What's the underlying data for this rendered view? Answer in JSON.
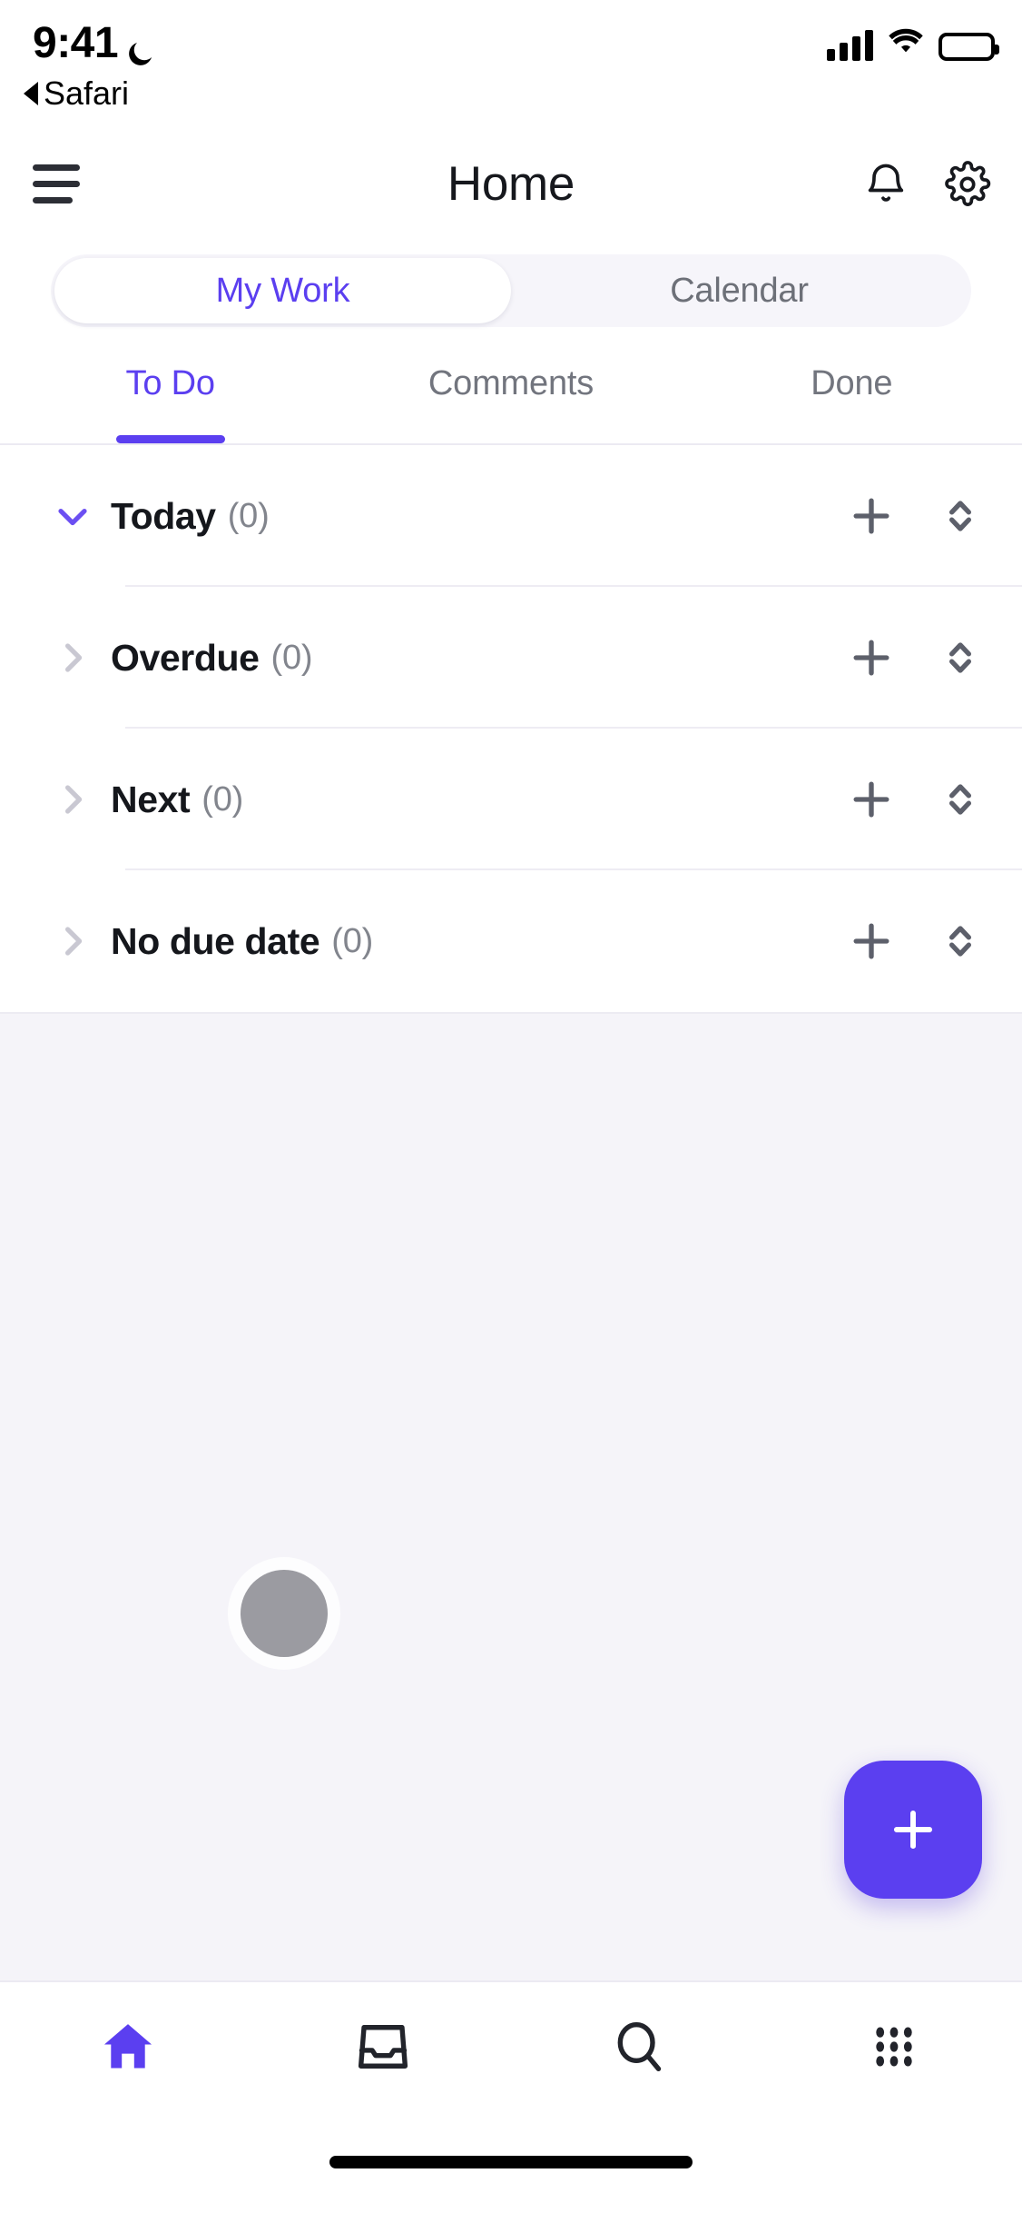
{
  "status_bar": {
    "time": "9:41",
    "dnd_icon": "moon-icon",
    "back_label": "Safari",
    "signal_icon": "cellular-signal-icon",
    "wifi_icon": "wifi-icon",
    "battery_icon": "battery-icon"
  },
  "header": {
    "menu_icon": "hamburger-menu-icon",
    "title": "Home",
    "notifications_icon": "bell-icon",
    "settings_icon": "gear-icon"
  },
  "segmented_control": {
    "options": [
      {
        "label": "My Work",
        "active": true
      },
      {
        "label": "Calendar",
        "active": false
      }
    ]
  },
  "tabs": [
    {
      "label": "To Do",
      "active": true
    },
    {
      "label": "Comments",
      "active": false
    },
    {
      "label": "Done",
      "active": false
    }
  ],
  "sections": [
    {
      "title": "Today",
      "count": "(0)",
      "expanded": true,
      "chevron_icon": "chevron-down-icon",
      "add_icon": "plus-icon",
      "sort_icon": "sort-chevrons-icon"
    },
    {
      "title": "Overdue",
      "count": "(0)",
      "expanded": false,
      "chevron_icon": "chevron-right-icon",
      "add_icon": "plus-icon",
      "sort_icon": "sort-chevrons-icon"
    },
    {
      "title": "Next",
      "count": "(0)",
      "expanded": false,
      "chevron_icon": "chevron-right-icon",
      "add_icon": "plus-icon",
      "sort_icon": "sort-chevrons-icon"
    },
    {
      "title": "No due date",
      "count": "(0)",
      "expanded": false,
      "chevron_icon": "chevron-right-icon",
      "add_icon": "plus-icon",
      "sort_icon": "sort-chevrons-icon"
    }
  ],
  "empty_area": {
    "avatar_icon": "avatar-placeholder-icon",
    "fab_icon": "plus-icon"
  },
  "bottom_nav": [
    {
      "name": "home",
      "icon": "home-icon",
      "active": true
    },
    {
      "name": "inbox",
      "icon": "inbox-tray-icon",
      "active": false
    },
    {
      "name": "search",
      "icon": "search-icon",
      "active": false
    },
    {
      "name": "apps",
      "icon": "grid-dots-icon",
      "active": false
    }
  ],
  "colors": {
    "accent": "#5b3ff0",
    "text_primary": "#15171c",
    "text_muted": "#82858d",
    "background": "#ffffff",
    "empty_background": "#f5f4f9",
    "avatar": "#9b9ba1",
    "icon_slate": "#5d606b"
  }
}
